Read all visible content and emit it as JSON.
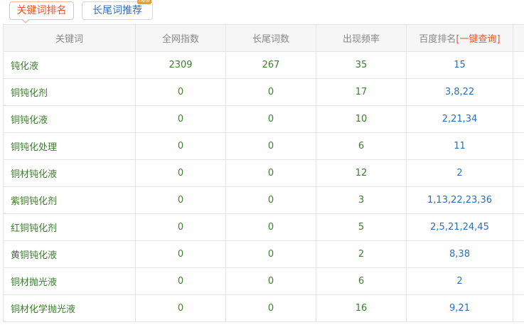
{
  "tabs": {
    "active_label": "关键词排名",
    "inactive_label": "长尾词推荐",
    "badge": "new"
  },
  "table": {
    "headers": {
      "keyword": "关键词",
      "index": "全网指数",
      "longtail": "长尾词数",
      "frequency": "出现频率",
      "rank": "百度排名",
      "rank_query": "[一键查询]"
    },
    "rows": [
      {
        "keyword": "钝化液",
        "index": "2309",
        "longtail": "267",
        "frequency": "35",
        "rank": "15"
      },
      {
        "keyword": "铜钝化剂",
        "index": "0",
        "longtail": "0",
        "frequency": "17",
        "rank": "3,8,22"
      },
      {
        "keyword": "铜钝化液",
        "index": "0",
        "longtail": "0",
        "frequency": "10",
        "rank": "2,21,34"
      },
      {
        "keyword": "铜钝化处理",
        "index": "0",
        "longtail": "0",
        "frequency": "6",
        "rank": "11"
      },
      {
        "keyword": "铜材钝化液",
        "index": "0",
        "longtail": "0",
        "frequency": "12",
        "rank": "2"
      },
      {
        "keyword": "紫铜钝化剂",
        "index": "0",
        "longtail": "0",
        "frequency": "3",
        "rank": "1,13,22,23,36"
      },
      {
        "keyword": "红铜钝化剂",
        "index": "0",
        "longtail": "0",
        "frequency": "5",
        "rank": "2,5,21,24,45"
      },
      {
        "keyword": "黄铜钝化液",
        "index": "0",
        "longtail": "0",
        "frequency": "2",
        "rank": "8,38"
      },
      {
        "keyword": "铜材抛光液",
        "index": "0",
        "longtail": "0",
        "frequency": "6",
        "rank": "2"
      },
      {
        "keyword": "铜材化学抛光液",
        "index": "0",
        "longtail": "0",
        "frequency": "16",
        "rank": "9,21"
      }
    ]
  }
}
